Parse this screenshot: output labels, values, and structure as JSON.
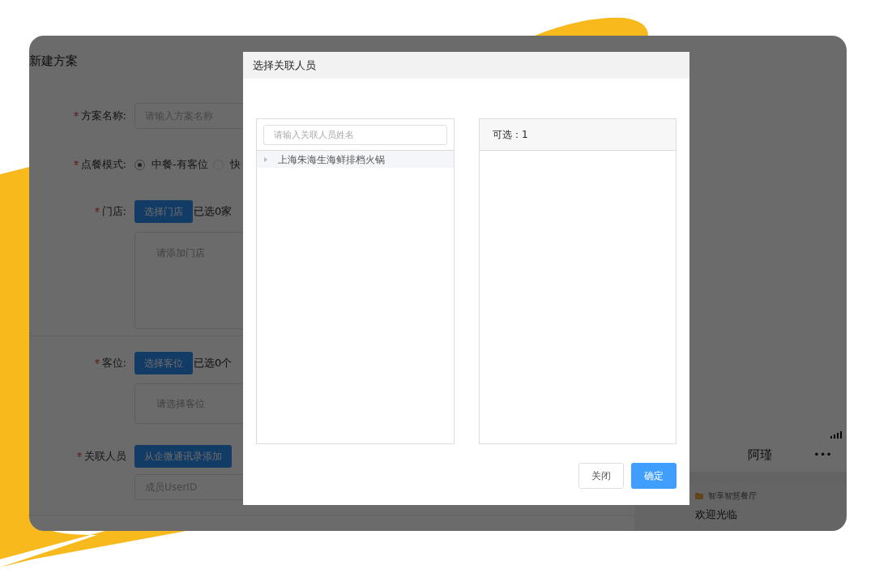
{
  "page_title": "新建方案",
  "form": {
    "sections": [
      [
        {
          "kind": "text",
          "label": "方案名称:",
          "required": true,
          "placeholder": "请输入方案名称"
        },
        {
          "kind": "radio",
          "label": "点餐模式:",
          "required": true,
          "options": [
            {
              "label": "中餐-有客位",
              "selected": true
            },
            {
              "label": "快",
              "selected": false
            }
          ]
        },
        {
          "kind": "picker_large",
          "label": "门店:",
          "required": true,
          "button": "选择门店",
          "count": "已选0家",
          "placeholder": "请添加门店"
        }
      ],
      [
        {
          "kind": "picker",
          "label": "客位:",
          "required": true,
          "button": "选择客位",
          "count": "已选0个",
          "placeholder": "请选择客位"
        },
        {
          "kind": "button_input",
          "label": "关联人员",
          "required": true,
          "button": "从企微通讯录添加",
          "placeholder": "成员UserID"
        }
      ]
    ]
  },
  "preview": {
    "contact_name": "阿瑾",
    "more": "•••",
    "shop_name": "智享智慧餐厅",
    "message": "欢迎光临"
  },
  "dialog": {
    "title": "选择关联人员",
    "search": {
      "placeholder": "请输入关联人员姓名"
    },
    "tree": [
      {
        "label": "上海朱海生海鲜排档火锅",
        "expanded": false
      }
    ],
    "available": "可选：1",
    "buttons": [
      {
        "label": "关闭",
        "kind": "secondary"
      },
      {
        "label": "确定",
        "kind": "primary"
      }
    ]
  }
}
